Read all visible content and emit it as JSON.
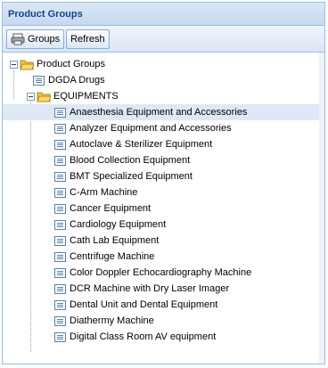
{
  "panel": {
    "title": "Product Groups"
  },
  "toolbar": {
    "groups_label": "Groups",
    "refresh_label": "Refresh"
  },
  "tree": {
    "root": "Product Groups",
    "dgda": "DGDA Drugs",
    "equipments": "EQUIPMENTS",
    "items": [
      "Anaesthesia Equipment and Accessories",
      "Analyzer Equipment and Accessories",
      "Autoclave & Sterilizer Equipment",
      "Blood Collection Equipment",
      "BMT Specialized Equipment",
      "C-Arm Machine",
      "Cancer Equipment",
      "Cardiology Equipment",
      "Cath Lab Equipment",
      "Centrifuge Machine",
      "Color Doppler Echocardiography Machine",
      "DCR Machine with Dry Laser Imager",
      "Dental Unit and Dental Equipment",
      "Diathermy Machine",
      "Digital Class Room AV equipment"
    ]
  },
  "colors": {
    "header_text": "#15428b",
    "selected_row": "#dfe8f6",
    "folder": "#f5c542"
  }
}
